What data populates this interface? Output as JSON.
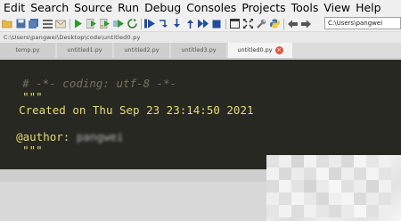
{
  "menubar": {
    "items": [
      "Edit",
      "Search",
      "Source",
      "Run",
      "Debug",
      "Consoles",
      "Projects",
      "Tools",
      "View",
      "Help"
    ]
  },
  "toolbar": {
    "path_value": "C:\\Users\\pangwei"
  },
  "filepath": {
    "text": "C:\\Users\\pangwei\\Desktop\\code\\untitled0.py"
  },
  "tabs": [
    {
      "label": "temp.py"
    },
    {
      "label": "untitled1.py"
    },
    {
      "label": "untitled2.py"
    },
    {
      "label": "untitled3.py"
    },
    {
      "label": "untitled0.py"
    }
  ],
  "editor": {
    "line1": "# -*- coding: utf-8 -*-",
    "line2": "\"\"\"",
    "line3": "Created on Thu Sep 23 23:14:50 2021",
    "line5_prefix": "@author: ",
    "line5_author": "pangwei",
    "line6": "\"\"\""
  }
}
